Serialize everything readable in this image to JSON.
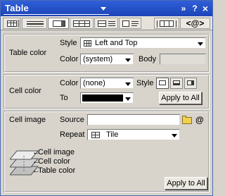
{
  "window": {
    "title": "Table",
    "buttons": {
      "menu": "»",
      "help": "?",
      "close": "×"
    }
  },
  "toolbar": {
    "tabs": [
      {
        "icon": "table-grid-icon"
      },
      {
        "icon": "image-icon"
      },
      {
        "icon": "row-lines-icon"
      },
      {
        "icon": "cell-highlight-icon"
      },
      {
        "icon": "columns-icon"
      },
      {
        "icon": "column-lines-icon"
      },
      {
        "icon": "bracket-cell-icon"
      },
      {
        "icon": "code-icon",
        "label": "<@>"
      }
    ],
    "active_index": 2
  },
  "table_color": {
    "group_label": "Table color",
    "style_label": "Style",
    "style_value": "Left and Top",
    "color_label": "Color",
    "color_value": "(system)",
    "body_label": "Body",
    "body_value": ""
  },
  "cell_color": {
    "group_label": "Cell color",
    "color_label": "Color",
    "color_value": "(none)",
    "style_label": "Style",
    "to_label": "To",
    "to_color": "#000000",
    "apply_all": "Apply to All"
  },
  "cell_image": {
    "group_label": "Cell image",
    "source_label": "Source",
    "source_value": "",
    "at_symbol": "@",
    "repeat_label": "Repeat",
    "repeat_value": "Tile",
    "layers": [
      "Cell image",
      "Cell color",
      "Table color"
    ],
    "apply_all": "Apply to All"
  }
}
